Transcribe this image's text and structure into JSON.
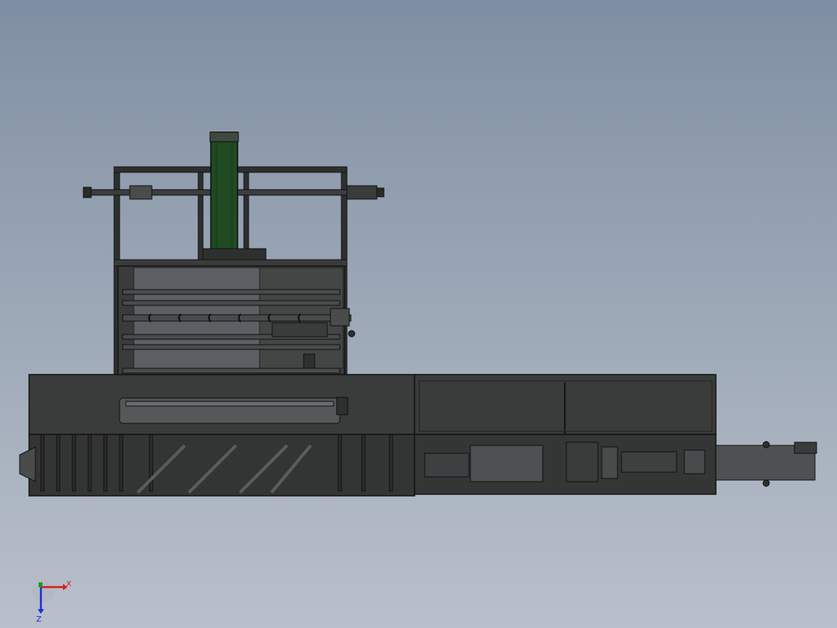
{
  "viewport": {
    "background_top": "#7f8fa3",
    "background_bottom": "#b9c0cb"
  },
  "model": {
    "frame_color": "#2e2f2f",
    "panel_color": "#3a3b3b",
    "edge_color": "#151515",
    "belt_color": "#1f4a22",
    "roller_color": "#4a4b4b"
  },
  "triad": {
    "x_label": "X",
    "z_label": "Z",
    "x_color": "#d81e1e",
    "y_color": "#1e9a1e",
    "z_color": "#1e2ed8"
  }
}
